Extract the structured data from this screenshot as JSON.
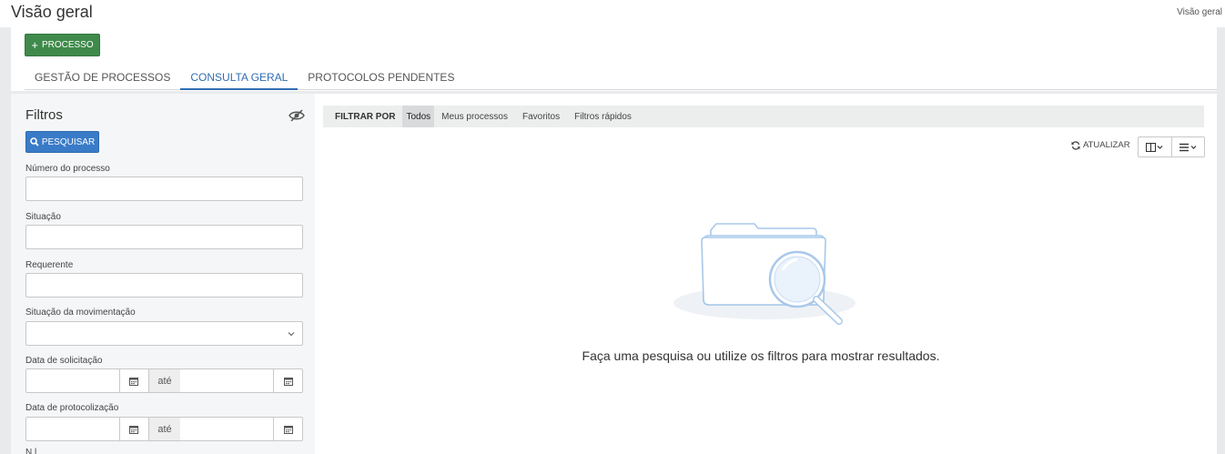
{
  "header": {
    "title": "Visão geral",
    "breadcrumb": "Visão geral"
  },
  "toolbar": {
    "new_process_label": "PROCESSO"
  },
  "tabs": [
    {
      "label": "GESTÃO DE PROCESSOS",
      "active": false
    },
    {
      "label": "CONSULTA GERAL",
      "active": true
    },
    {
      "label": "PROTOCOLOS PENDENTES",
      "active": false
    }
  ],
  "filters": {
    "title": "Filtros",
    "search_button": "PESQUISAR",
    "fields": {
      "numero": {
        "label": "Número do processo",
        "value": ""
      },
      "situacao": {
        "label": "Situação",
        "value": ""
      },
      "requerente": {
        "label": "Requerente",
        "value": ""
      },
      "situacao_mov": {
        "label": "Situação da movimentação",
        "value": ""
      },
      "data_solicitacao": {
        "label": "Data de solicitação",
        "from": "",
        "to": "",
        "separator": "até"
      },
      "data_protocolizacao": {
        "label": "Data de protocolização",
        "from": "",
        "to": "",
        "separator": "até"
      },
      "next_label_partial": "N  l  "
    }
  },
  "filter_bar": {
    "label": "FILTRAR POR",
    "items": [
      {
        "label": "Todos",
        "active": true
      },
      {
        "label": "Meus processos",
        "active": false
      },
      {
        "label": "Favoritos",
        "active": false
      },
      {
        "label": "Filtros rápidos",
        "active": false
      }
    ]
  },
  "results": {
    "refresh_label": "ATUALIZAR",
    "empty_message": "Faça uma pesquisa ou utilize os filtros para mostrar resultados."
  },
  "colors": {
    "primary_green": "#3f8a4a",
    "primary_blue": "#3a7bc8",
    "tab_active": "#2f6db3",
    "illustration": "#a8c8ea"
  },
  "icons": [
    "plus-icon",
    "search-icon",
    "eye-slash-icon",
    "chevron-down-icon",
    "calendar-icon",
    "refresh-icon",
    "columns-icon",
    "list-icon",
    "folder-search-icon"
  ]
}
